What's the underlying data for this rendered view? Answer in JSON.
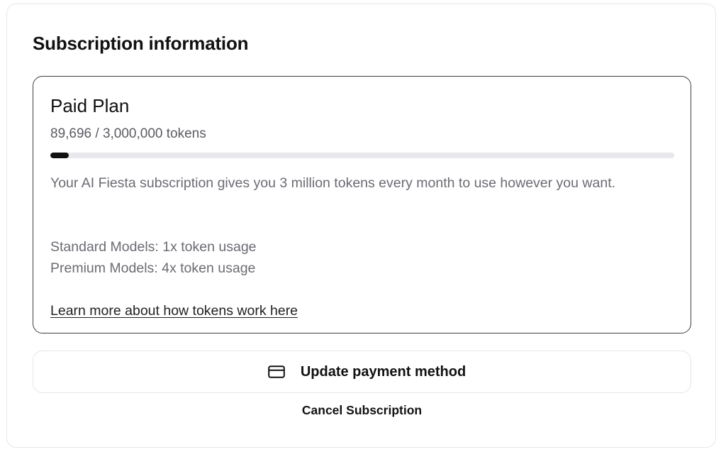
{
  "section": {
    "title": "Subscription information"
  },
  "plan": {
    "name": "Paid Plan",
    "usage_text": "89,696 / 3,000,000 tokens",
    "usage_fraction": 0.0299,
    "description": "Your AI Fiesta subscription gives you 3 million tokens every month to use however you want.",
    "rates": [
      "Standard Models: 1x token usage",
      "Premium Models: 4x token usage"
    ],
    "learn_more_label": "Learn more about how tokens work here"
  },
  "actions": {
    "update_payment_label": "Update payment method",
    "update_payment_icon": "credit-card-icon",
    "cancel_label": "Cancel Subscription"
  },
  "colors": {
    "progress_fill": "#111111",
    "progress_track": "#e9e9ed",
    "card_border": "#3f3f46"
  }
}
